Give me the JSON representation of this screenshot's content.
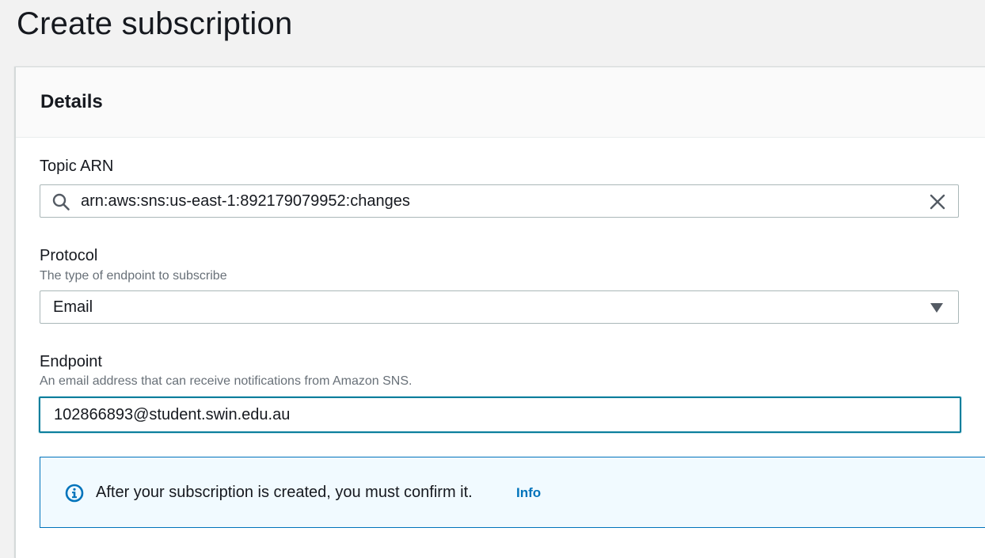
{
  "page": {
    "title": "Create subscription"
  },
  "details": {
    "heading": "Details",
    "topic_arn": {
      "label": "Topic ARN",
      "value": "arn:aws:sns:us-east-1:892179079952:changes"
    },
    "protocol": {
      "label": "Protocol",
      "description": "The type of endpoint to subscribe",
      "selected": "Email"
    },
    "endpoint": {
      "label": "Endpoint",
      "description": "An email address that can receive notifications from Amazon SNS.",
      "value": "102866893@student.swin.edu.au"
    },
    "alert": {
      "message": "After your subscription is created, you must confirm it.",
      "link": "Info"
    }
  },
  "colors": {
    "accent_blue": "#0073bb",
    "focus_teal": "#0a7e9c",
    "alert_background": "#f1faff"
  },
  "icons": {
    "topic_search": "search-icon",
    "topic_clear": "close-icon",
    "protocol_dropdown": "caret-down-icon",
    "alert": "info-icon"
  }
}
